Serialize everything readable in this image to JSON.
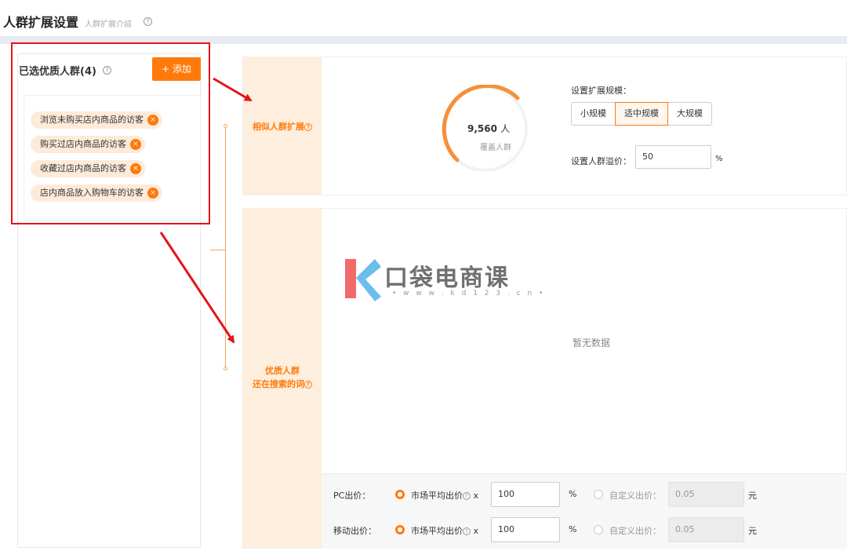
{
  "header": {
    "title": "人群扩展设置",
    "intro_link": "人群扩展介绍",
    "help_glyph": "?"
  },
  "selected": {
    "title": "已选优质人群(4)",
    "add_label": "+ 添加",
    "tags": [
      "浏览未购买店内商品的访客",
      "购买过店内商品的访客",
      "收藏过店内商品的访客",
      "店内商品放入购物车的访客"
    ],
    "remove_glyph": "×"
  },
  "similar": {
    "side_label": "相似人群扩展",
    "coverage_value": "9,560",
    "coverage_unit": "人",
    "coverage_label": "覆盖人群",
    "scale_label": "设置扩展规模：",
    "scale_options": [
      "小规模",
      "适中规模",
      "大规模"
    ],
    "scale_selected": "适中规模",
    "premium_label": "设置人群溢价：",
    "premium_value": "50",
    "premium_unit": "%"
  },
  "search_terms": {
    "side_label_line1": "优质人群",
    "side_label_line2": "还在搜索的词",
    "empty_text": "暂无数据"
  },
  "watermark": {
    "text": "口袋电商课",
    "url": "• w w w . k d 1 2 3 . c n •"
  },
  "bids": [
    {
      "label": "PC出价：",
      "option_market": "市场平均出价",
      "multiply": "x",
      "market_value": "100",
      "market_unit": "%",
      "option_custom": "自定义出价：",
      "custom_value": "0.05",
      "custom_unit": "元",
      "selected": "market"
    },
    {
      "label": "移动出价：",
      "option_market": "市场平均出价",
      "multiply": "x",
      "market_value": "100",
      "market_unit": "%",
      "option_custom": "自定义出价：",
      "custom_value": "0.05",
      "custom_unit": "元",
      "selected": "market"
    }
  ],
  "colors": {
    "accent": "#ff7a0b",
    "side_bg": "#fdeedd",
    "tag_bg": "#fdebd9",
    "highlight_red": "#e4141b"
  }
}
